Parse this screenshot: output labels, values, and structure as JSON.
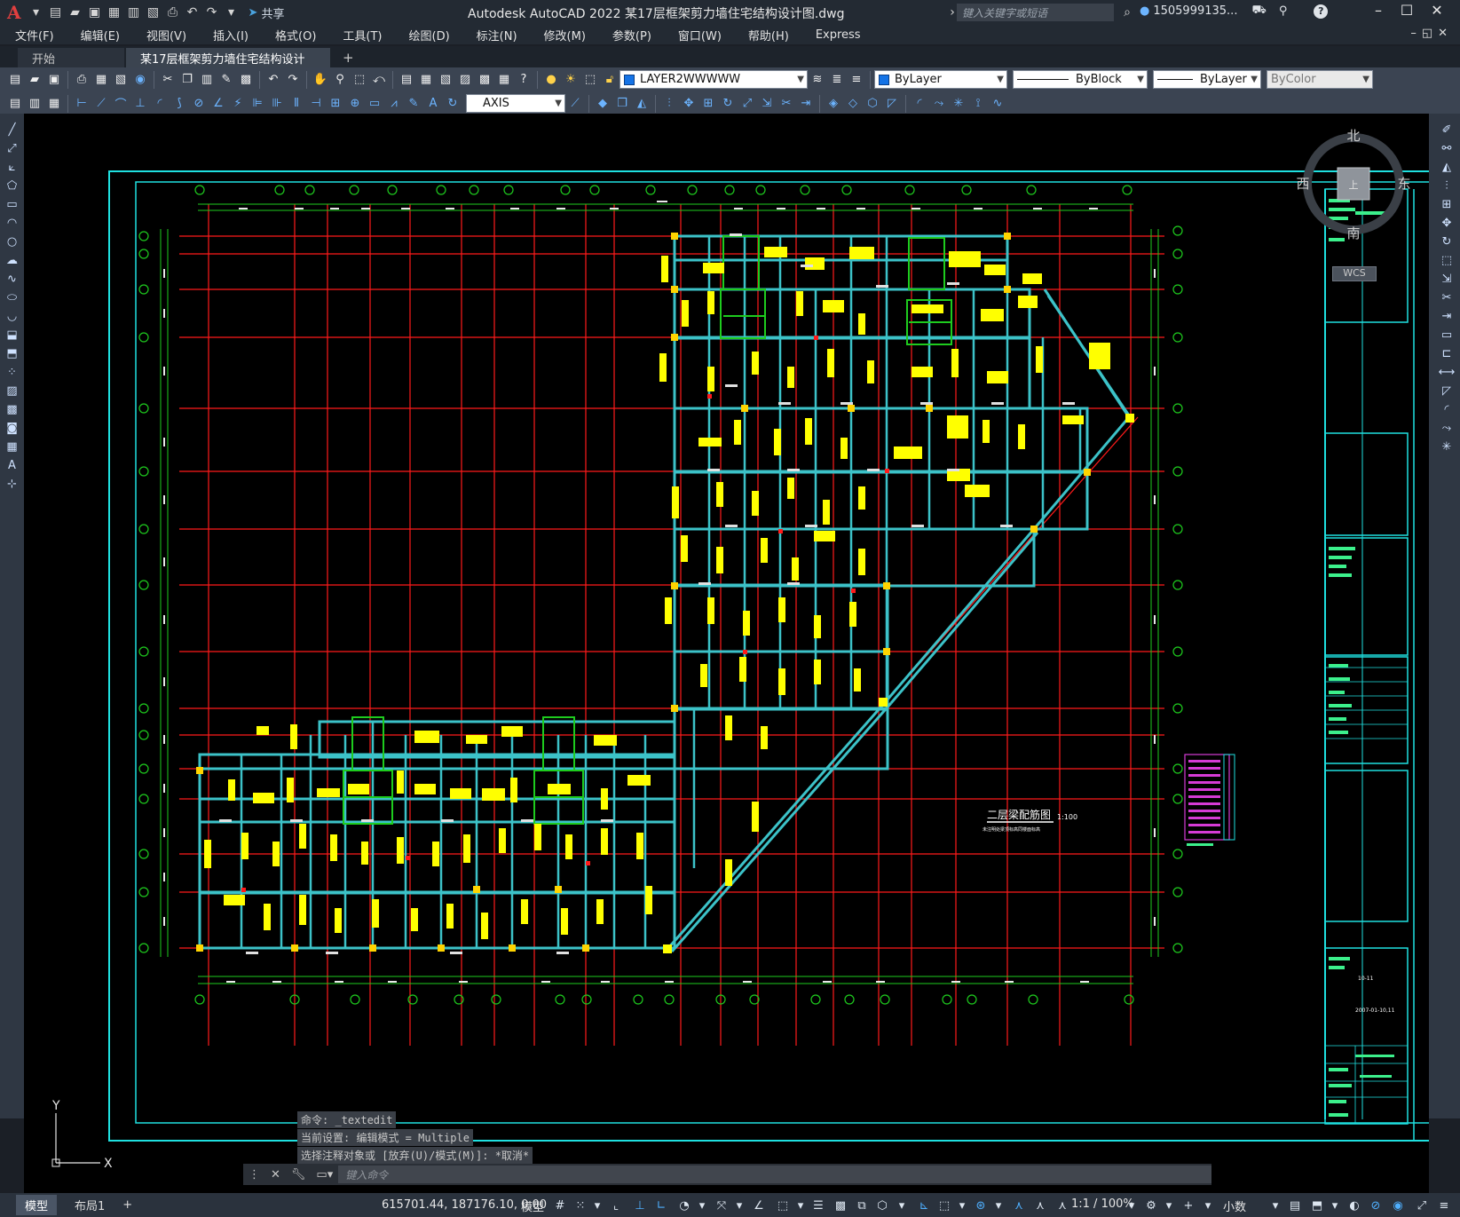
{
  "app": {
    "logo": "A",
    "title": "Autodesk AutoCAD 2022    某17层框架剪力墙住宅结构设计图.dwg",
    "search_placeholder": "键入关键字或短语",
    "user": "1505999135...",
    "share_label": "共享"
  },
  "menu": [
    "文件(F)",
    "编辑(E)",
    "视图(V)",
    "插入(I)",
    "格式(O)",
    "工具(T)",
    "绘图(D)",
    "标注(N)",
    "修改(M)",
    "参数(P)",
    "窗口(W)",
    "帮助(H)",
    "Express"
  ],
  "tabs": [
    {
      "label": "开始",
      "active": false
    },
    {
      "label": "某17层框架剪力墙住宅结构设计图*",
      "active": true
    }
  ],
  "layers": {
    "current_layer": "LAYER2WWWWW",
    "color": "ByLayer",
    "linetype": "ByBlock",
    "lineweight": "ByLayer",
    "plotstyle": "ByColor",
    "dimstyle": "AXIS"
  },
  "viewcube": {
    "north": "北",
    "south": "南",
    "east": "东",
    "west": "西",
    "top": "上",
    "wcs": "WCS"
  },
  "drawing": {
    "plan_title": "二层梁配筋图",
    "scale": "1:100",
    "subtitle": "未注明处梁顶标高同楼面标高",
    "titleblock_no": "10-11",
    "titleblock_date": "2007-01-10,11"
  },
  "commands": {
    "history": [
      "命令: _textedit",
      "当前设置: 编辑模式 = Multiple",
      "选择注释对象或 [放弃(U)/模式(M)]: *取消*"
    ],
    "input_placeholder": "键入命令"
  },
  "status": {
    "tabs": [
      "模型",
      "布局1"
    ],
    "coords": "615701.44, 187176.10, 0.00",
    "model": "模型",
    "scale": "1:1 / 100%",
    "units": "小数"
  },
  "colors": {
    "grid_red": "#ff1a1a",
    "axis_green": "#1ecb1e",
    "frame_cyan": "#1fe0e0",
    "beam_teal": "#3cc2c8",
    "text_yellow": "#ffff00"
  }
}
